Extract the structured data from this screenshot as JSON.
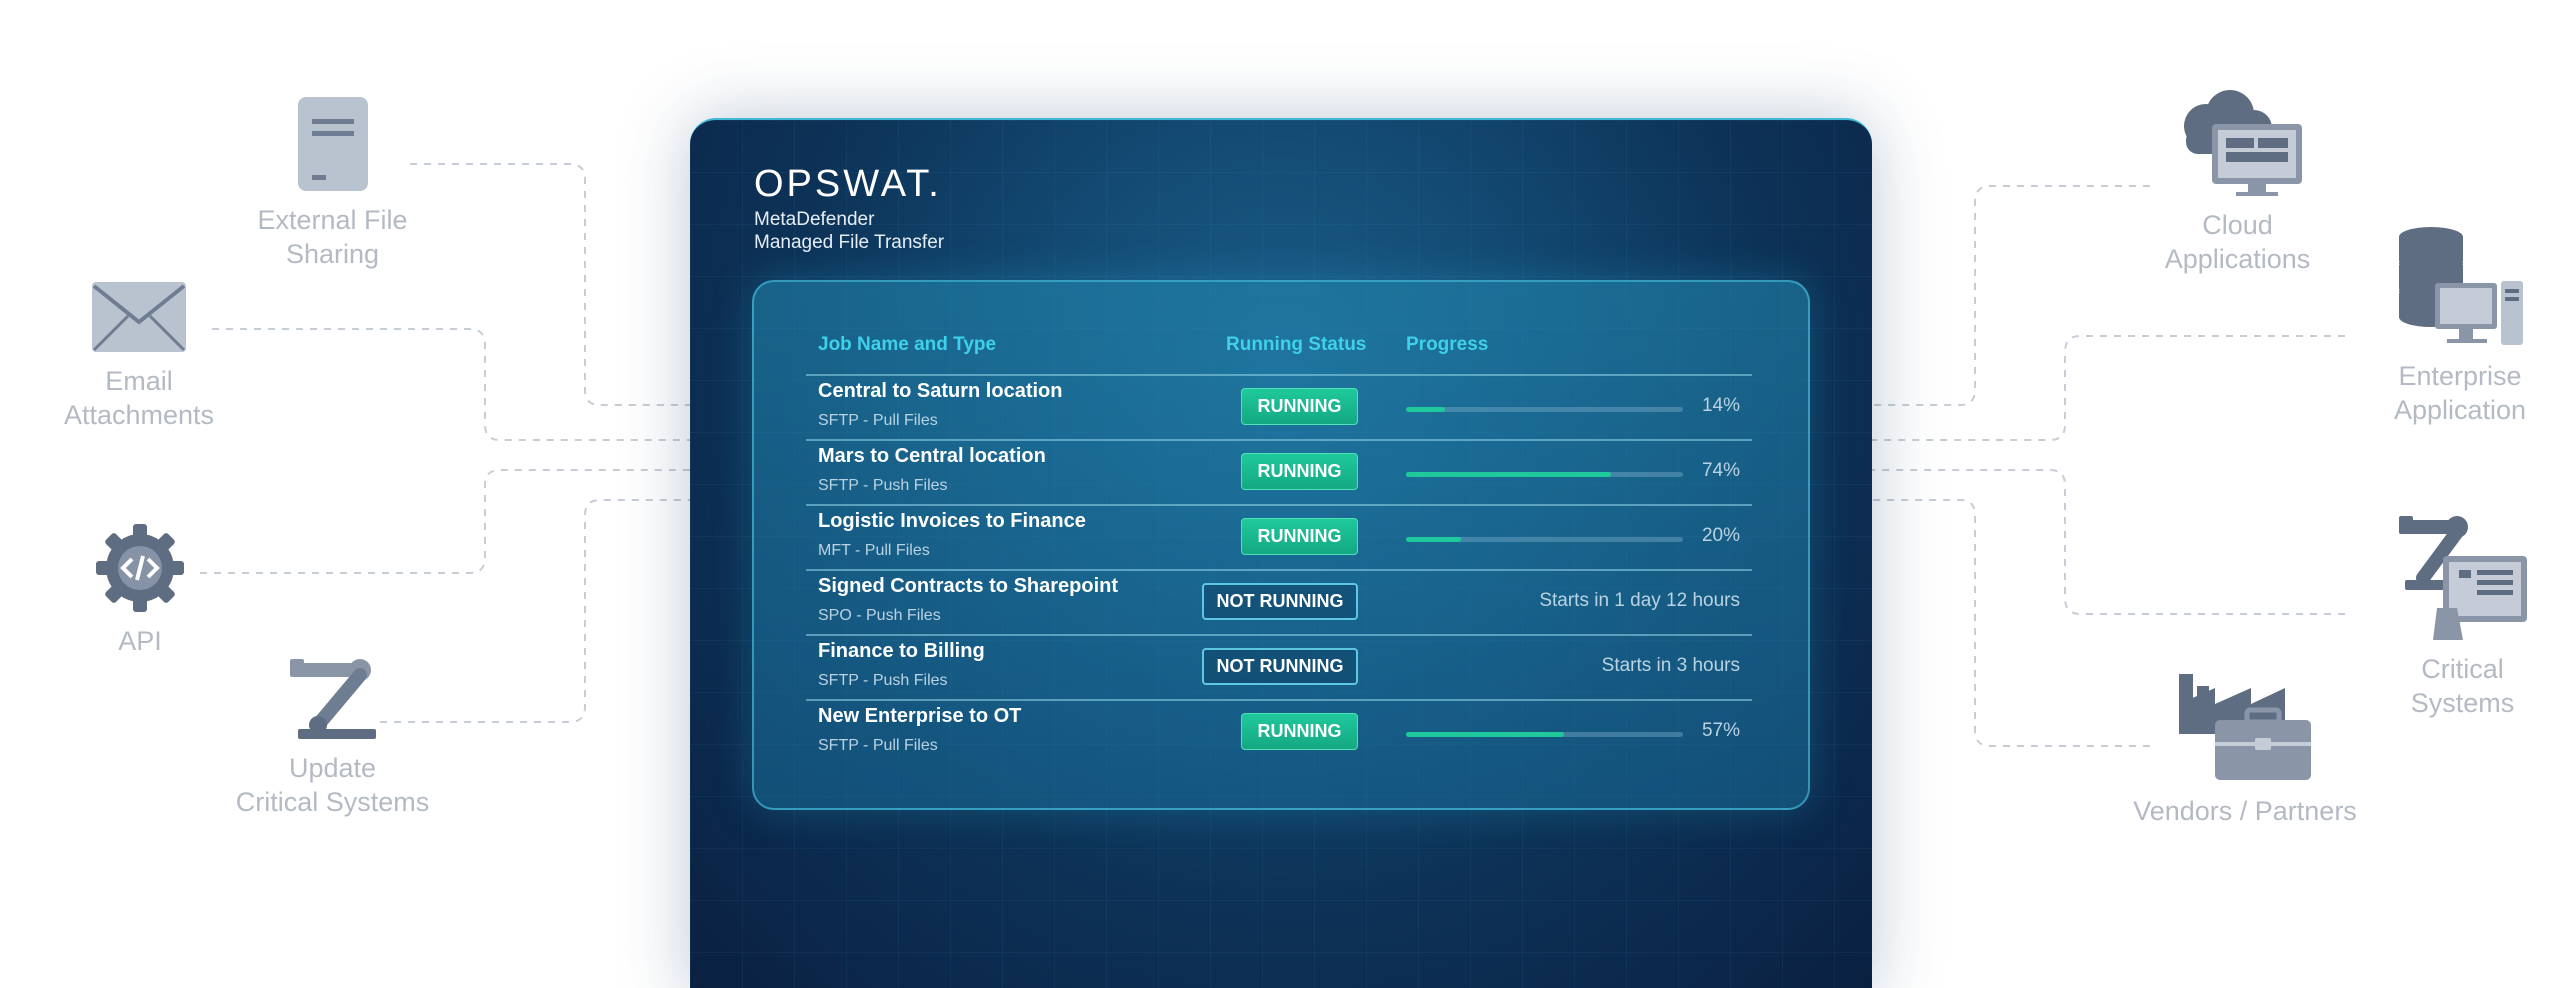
{
  "colors": {
    "accent": "#3fd0ea",
    "running": "#1fc99b",
    "panel": "#0d3257",
    "node_text": "#b4bac3",
    "node_icon": "#5f6d82"
  },
  "brand": {
    "logo": "OPSWAT.",
    "product_line1": "MetaDefender",
    "product_line2": "Managed File Transfer"
  },
  "table": {
    "headers": {
      "job": "Job Name and Type",
      "status": "Running Status",
      "progress": "Progress"
    },
    "rows": [
      {
        "name": "Central to Saturn location",
        "type": "SFTP - Pull Files",
        "status": "RUNNING",
        "running": true,
        "progress": 14,
        "progress_text": "14%"
      },
      {
        "name": "Mars to Central location",
        "type": "SFTP - Push Files",
        "status": "RUNNING",
        "running": true,
        "progress": 74,
        "progress_text": "74%"
      },
      {
        "name": "Logistic Invoices to Finance",
        "type": "MFT - Pull Files",
        "status": "RUNNING",
        "running": true,
        "progress": 20,
        "progress_text": "20%"
      },
      {
        "name": "Signed Contracts to Sharepoint",
        "type": "SPO - Push Files",
        "status": "NOT RUNNING",
        "running": false,
        "progress": null,
        "progress_text": "Starts in 1 day 12 hours"
      },
      {
        "name": "Finance to Billing",
        "type": "SFTP - Push Files",
        "status": "NOT RUNNING",
        "running": false,
        "progress": null,
        "progress_text": "Starts in 3 hours"
      },
      {
        "name": "New Enterprise to OT",
        "type": "SFTP - Pull Files",
        "status": "RUNNING",
        "running": true,
        "progress": 57,
        "progress_text": "57%"
      }
    ]
  },
  "sources": [
    {
      "label": "External File\nSharing",
      "icon": "document-icon"
    },
    {
      "label": "Email\nAttachments",
      "icon": "envelope-icon"
    },
    {
      "label": "API",
      "icon": "code-gear-icon"
    },
    {
      "label": "Update\nCritical Systems",
      "icon": "robot-arm-icon"
    }
  ],
  "destinations": [
    {
      "label": "Cloud\nApplications",
      "icon": "cloud-monitor-icon"
    },
    {
      "label": "Enterprise\nApplication",
      "icon": "database-server-icon"
    },
    {
      "label": "Critical\nSystems",
      "icon": "robot-arm-hmi-icon"
    },
    {
      "label": "Vendors / Partners",
      "icon": "factory-briefcase-icon"
    }
  ]
}
